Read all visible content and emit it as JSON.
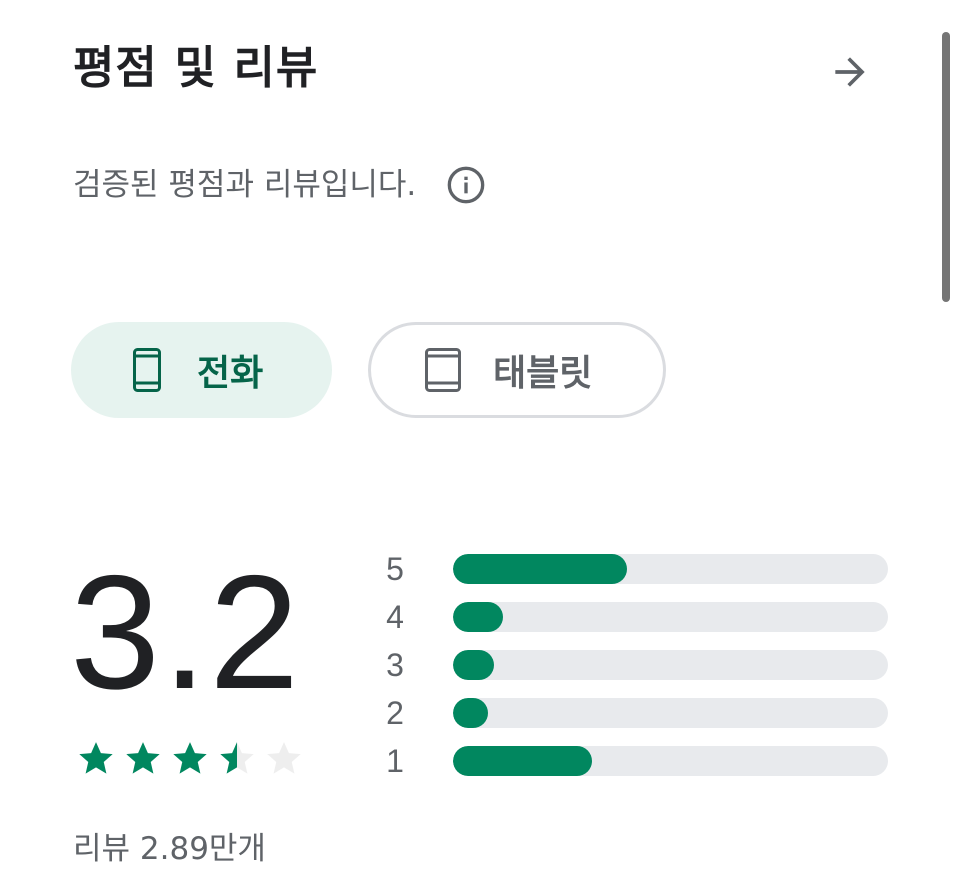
{
  "header": {
    "title": "평점 및 리뷰",
    "arrow_icon": "arrow-right-icon"
  },
  "subtitle": {
    "text": "검증된 평점과 리뷰입니다.",
    "info_icon": "info-icon"
  },
  "device_chips": [
    {
      "label": "전화",
      "icon": "phone-icon",
      "selected": true
    },
    {
      "label": "태블릿",
      "icon": "tablet-icon",
      "selected": false
    }
  ],
  "rating": {
    "score": "3.2",
    "stars_filled": 3.5,
    "stars_total": 5,
    "review_count": "리뷰 2.89만개"
  },
  "histogram": [
    {
      "label": "5",
      "fraction": 0.4
    },
    {
      "label": "4",
      "fraction": 0.115
    },
    {
      "label": "3",
      "fraction": 0.095
    },
    {
      "label": "2",
      "fraction": 0.08
    },
    {
      "label": "1",
      "fraction": 0.32
    }
  ],
  "colors": {
    "accent": "#01875f",
    "accent_text": "#056449",
    "chip_selected_bg": "#e6f3ef",
    "track": "#e8eaed",
    "empty_star": "#eeeeee"
  }
}
